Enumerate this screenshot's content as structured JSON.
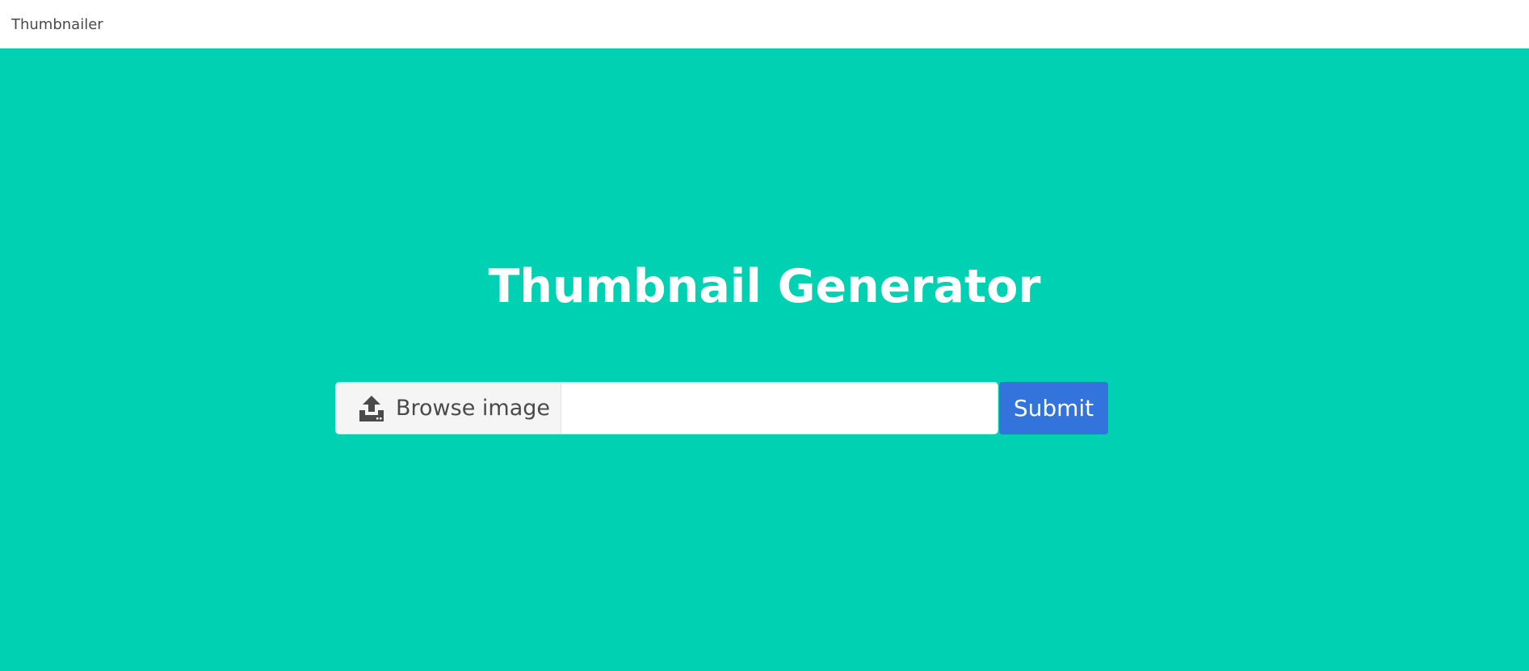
{
  "navbar": {
    "brand": "Thumbnailer"
  },
  "hero": {
    "title": "Thumbnail Generator"
  },
  "upload": {
    "browse_label": "Browse image",
    "browse_icon": "upload-icon",
    "file_name_value": "",
    "submit_label": "Submit"
  },
  "colors": {
    "hero_background": "#00d1b2",
    "navbar_background": "#ffffff",
    "submit_background": "#3273dc",
    "file_cta_background": "#f5f5f5",
    "text_dark": "#4a4a4a"
  }
}
